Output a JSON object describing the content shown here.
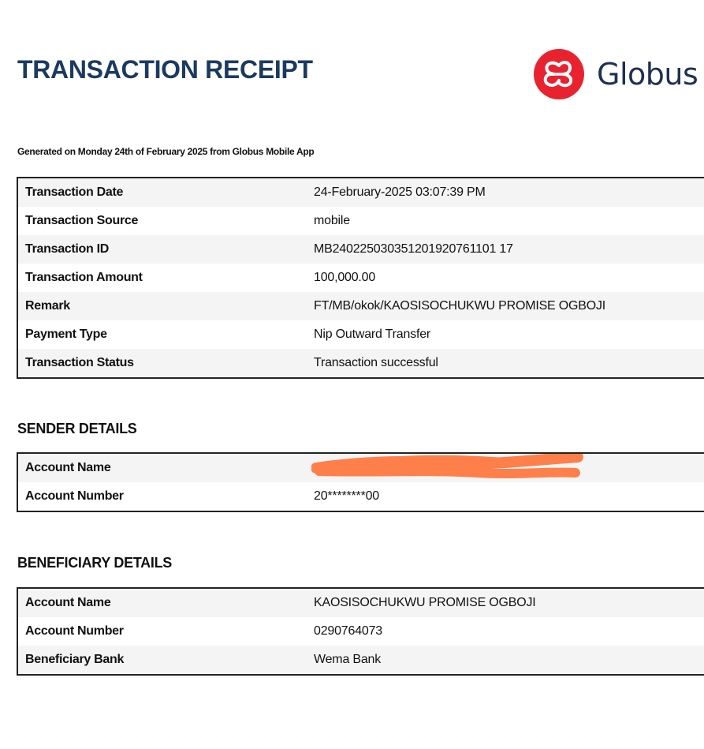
{
  "header": {
    "title": "TRANSACTION RECEIPT",
    "logo_text": "Globus B"
  },
  "generated_note": "Generated on Monday 24th of February 2025 from Globus Mobile App",
  "transaction": {
    "rows": [
      {
        "label": "Transaction Date",
        "value": "24-February-2025 03:07:39 PM"
      },
      {
        "label": "Transaction Source",
        "value": "mobile"
      },
      {
        "label": "Transaction ID",
        "value": "MB240225030351201920761101 17"
      },
      {
        "label": "Transaction Amount",
        "value": "100,000.00"
      },
      {
        "label": "Remark",
        "value": "FT/MB/okok/KAOSISOCHUKWU PROMISE OGBOJI"
      },
      {
        "label": "Payment Type",
        "value": "Nip Outward Transfer"
      },
      {
        "label": "Transaction Status",
        "value": "Transaction successful"
      }
    ]
  },
  "sender": {
    "title": "SENDER DETAILS",
    "rows": [
      {
        "label": "Account Name",
        "value": ""
      },
      {
        "label": "Account Number",
        "value": "20********00"
      }
    ]
  },
  "beneficiary": {
    "title": "BENEFICIARY DETAILS",
    "rows": [
      {
        "label": "Account Name",
        "value": "KAOSISOCHUKWU PROMISE OGBOJI"
      },
      {
        "label": "Account Number",
        "value": "0290764073"
      },
      {
        "label": "Beneficiary Bank",
        "value": "Wema Bank"
      }
    ]
  },
  "colors": {
    "title": "#1b3a5e",
    "brand_red": "#e8232f",
    "redaction": "#ff7f4a"
  },
  "icons": {
    "logo_mark": "globus-logo-icon",
    "redaction_mark": "redaction-scribble"
  }
}
